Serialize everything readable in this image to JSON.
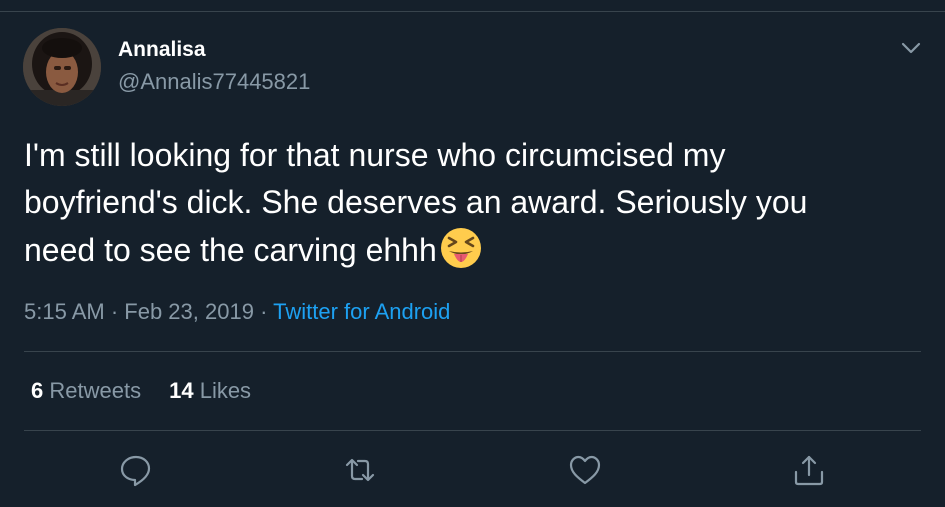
{
  "user": {
    "display_name": "Annalisa",
    "handle": "@Annalis77445821",
    "avatar_icon": "profile-photo"
  },
  "tweet": {
    "text": "I'm still looking for that nurse who circumcised my\nboyfriend's dick. She deserves an award. Seriously you\nneed to see the carving ehhh",
    "emoji": "squinting-face-with-tongue"
  },
  "meta": {
    "time": "5:15 AM",
    "separator": " · ",
    "date": "Feb 23, 2019",
    "source": "Twitter for Android"
  },
  "stats": {
    "retweets_count": "6",
    "retweets_label": "Retweets",
    "likes_count": "14",
    "likes_label": "Likes"
  },
  "actions": [
    "reply-icon",
    "retweet-icon",
    "like-icon",
    "share-icon"
  ],
  "colors": {
    "background": "#15202b",
    "text": "#ffffff",
    "secondary": "#8899a6",
    "link": "#1da1f2",
    "divider": "#38444d"
  }
}
